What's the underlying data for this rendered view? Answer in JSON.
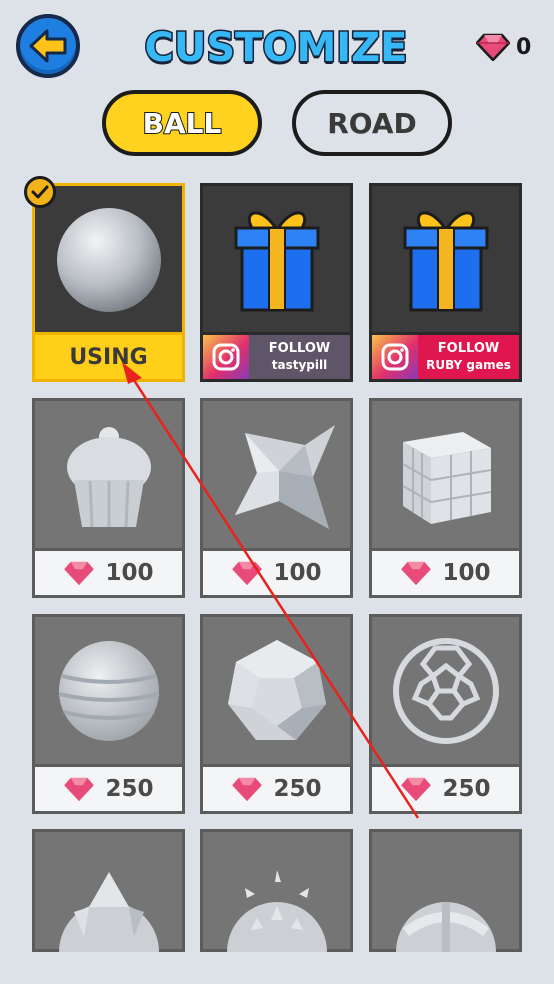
{
  "header": {
    "title": "CUSTOMIZE",
    "gem_count": "0",
    "back_icon": "arrow-left-icon"
  },
  "tabs": [
    {
      "label": "BALL",
      "active": true
    },
    {
      "label": "ROAD",
      "active": false
    }
  ],
  "colors": {
    "accent_yellow": "#ffd21f",
    "title_blue": "#35b8f5",
    "gem_pink": "#e84a7a",
    "card_gray": "#757575",
    "annotation_red": "#e8231e"
  },
  "items": [
    {
      "status": "USING",
      "shape": "sphere"
    },
    {
      "follow_title": "FOLLOW",
      "follow_handle": "tastypill",
      "icon": "instagram-icon"
    },
    {
      "follow_title": "FOLLOW",
      "follow_handle": "RUBY games",
      "icon": "instagram-icon"
    },
    {
      "price": "100",
      "shape": "cupcake"
    },
    {
      "price": "100",
      "shape": "star-tetrahedron"
    },
    {
      "price": "100",
      "shape": "cube-grid"
    },
    {
      "price": "250",
      "shape": "ringed-sphere"
    },
    {
      "price": "250",
      "shape": "polyhedron"
    },
    {
      "price": "250",
      "shape": "buckyball"
    },
    {
      "shape": "faceted-ball"
    },
    {
      "shape": "spiky-ball"
    },
    {
      "shape": "banded-ball"
    }
  ]
}
